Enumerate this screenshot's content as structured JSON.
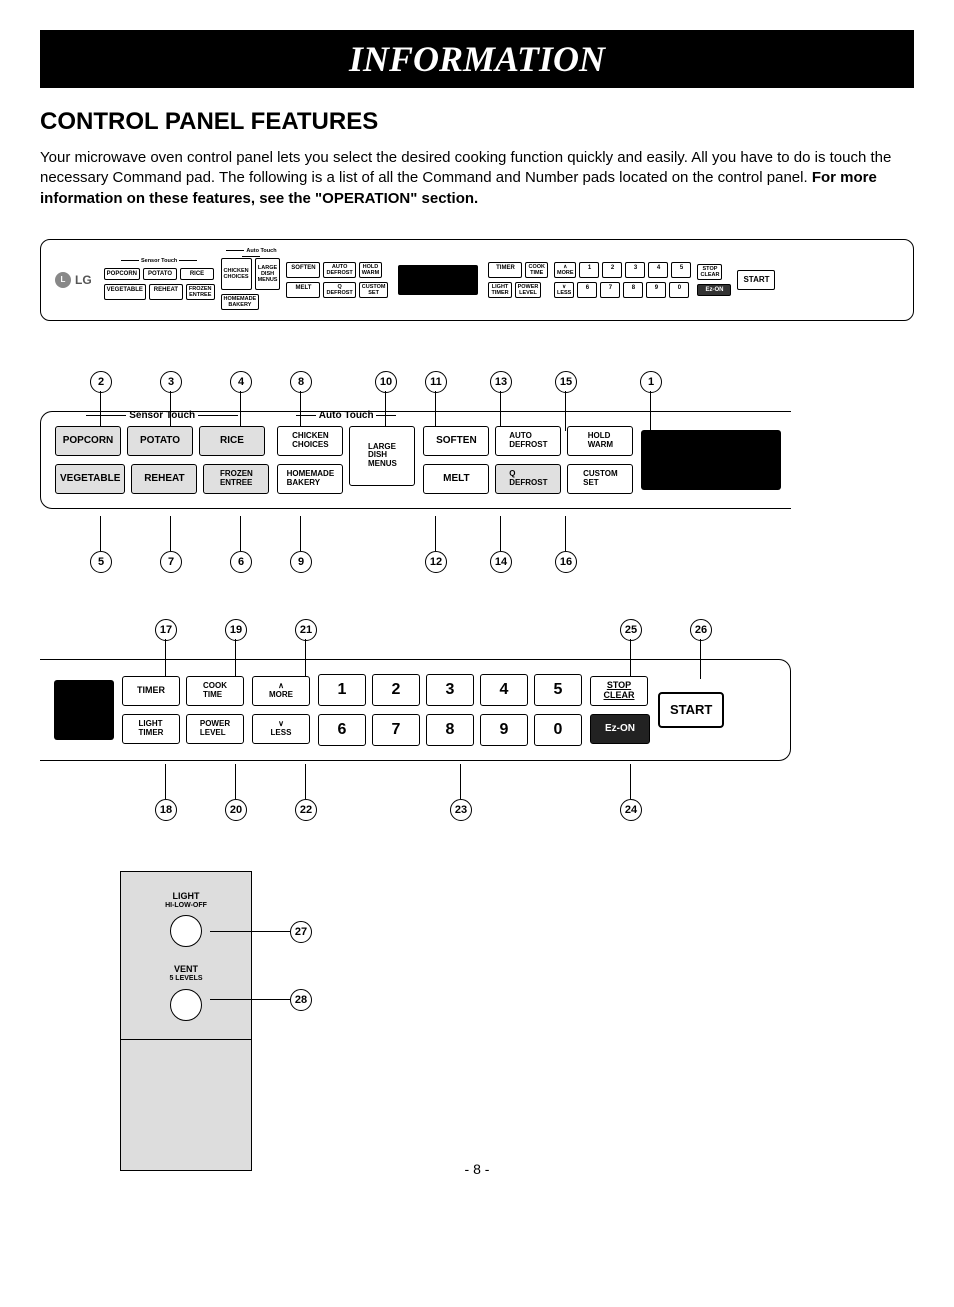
{
  "header": "INFORMATION",
  "title": "CONTROL PANEL FEATURES",
  "intro_plain": "Your microwave oven control panel lets you select the desired cooking function quickly and easily. All you have to do is touch the necessary Command pad. The following is a list of all the Command and Number pads located on the control panel. ",
  "intro_bold": "For more information on these features, see the \"OPERATION\" section.",
  "logo": "LG",
  "groups": {
    "sensor": "Sensor Touch",
    "auto": "Auto Touch"
  },
  "sensor_row1": [
    "POPCORN",
    "POTATO",
    "RICE"
  ],
  "sensor_row2": [
    "VEGETABLE",
    "REHEAT",
    "FROZEN\nENTREE"
  ],
  "auto_col1": [
    "CHICKEN\nCHOICES",
    "HOMEMADE\nBAKERY"
  ],
  "auto_large": "LARGE\nDISH\nMENUS",
  "mid_row1": [
    "SOFTEN",
    "AUTO\nDEFROST",
    "HOLD\nWARM"
  ],
  "mid_row2": [
    "MELT",
    "Q\nDEFROST",
    "CUSTOM\nSET"
  ],
  "timer_row1": [
    "TIMER",
    "COOK\nTIME"
  ],
  "timer_row2": [
    "LIGHT\nTIMER",
    "POWER\nLEVEL"
  ],
  "more": "MORE",
  "less": "LESS",
  "nums_row1": [
    "1",
    "2",
    "3",
    "4",
    "5"
  ],
  "nums_row2": [
    "6",
    "7",
    "8",
    "9",
    "0"
  ],
  "stopclear_top": "STOP",
  "stopclear_bot": "CLEAR",
  "ezon": "Ez-ON",
  "start": "START",
  "light_label": "LIGHT",
  "light_sub": "HI-LOW-OFF",
  "vent_label": "VENT",
  "vent_sub": "5 LEVELS",
  "callouts_top": {
    "1": 1,
    "2": 2,
    "3": 3,
    "4": 4,
    "5": 5,
    "6": 6,
    "7": 7,
    "8": 8,
    "9": 9,
    "10": 10,
    "11": 11,
    "12": 12,
    "13": 13,
    "14": 14,
    "15": 15,
    "16": 16
  },
  "callouts_bot": {
    "17": 17,
    "18": 18,
    "19": 19,
    "20": 20,
    "21": 21,
    "22": 22,
    "23": 23,
    "24": 24,
    "25": 25,
    "26": 26
  },
  "callouts_knob": {
    "27": 27,
    "28": 28
  },
  "page": "- 8 -"
}
